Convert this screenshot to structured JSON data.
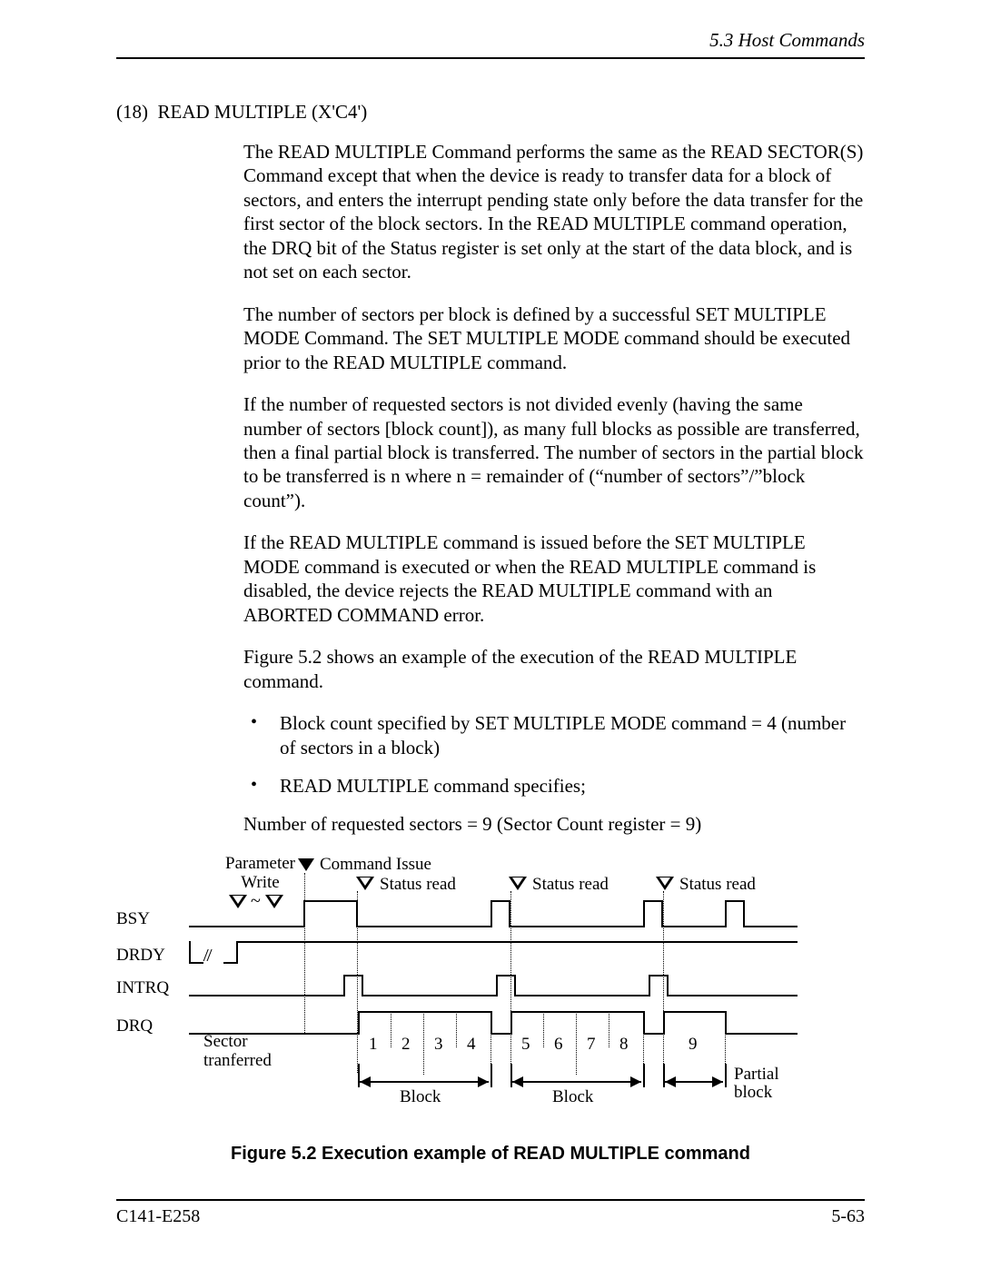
{
  "header": {
    "section": "5.3  Host Commands"
  },
  "title": "(18)  READ MULTIPLE (X'C4')",
  "paragraphs": {
    "p1": "The READ MULTIPLE Command performs the same as the READ SECTOR(S) Command except that when the device is ready to transfer data for a block of sectors, and enters the interrupt pending state only before the data transfer for the first sector of the block sectors.  In the READ MULTIPLE command operation, the DRQ bit of the Status register is set only at the start of the data block, and is not set on each sector.",
    "p2": "The number of sectors per block is defined by a successful SET MULTIPLE MODE Command.  The SET MULTIPLE MODE command should be executed prior to the READ MULTIPLE command.",
    "p3": "If the number of requested sectors is not divided evenly (having the same number of sectors [block count]), as many full blocks as possible are transferred, then a final partial block is transferred. The number of sectors in the partial block to be transferred is n where n = remainder of (“number of sectors”/”block count”).",
    "p4": "If the READ MULTIPLE command is issued before the SET MULTIPLE MODE command is executed or when the READ MULTIPLE command is disabled, the device rejects the READ MULTIPLE command with an ABORTED COMMAND error.",
    "p5": "Figure 5.2 shows an example of the execution of the READ MULTIPLE command.",
    "b1": "Block count specified by SET MULTIPLE MODE command = 4 (number of sectors in a block)",
    "b2": "READ MULTIPLE command specifies;",
    "p6": "Number of requested sectors = 9 (Sector Count register = 9)"
  },
  "figure": {
    "labels": {
      "param_write": "Parameter\nWrite",
      "command_issue": "Command Issue",
      "status_read": "Status read",
      "sector_transferred": "Sector\ntranferred",
      "block": "Block",
      "partial_block": "Partial\nblock"
    },
    "signals": [
      "BSY",
      "DRDY",
      "INTRQ",
      "DRQ"
    ],
    "sectors": [
      "1",
      "2",
      "3",
      "4",
      "5",
      "6",
      "7",
      "8",
      "9"
    ],
    "caption": "Figure 5.2  Execution example of READ MULTIPLE command"
  },
  "footer": {
    "left": "C141-E258",
    "right": "5-63"
  },
  "chart_data": {
    "type": "timing-diagram",
    "description": "READ MULTIPLE command execution: BSY, DRDY, INTRQ, DRQ signal timing across 9 sector transfers grouped into two full blocks of 4 and one partial block of 1.",
    "block_count": 4,
    "requested_sectors": 9,
    "groups": [
      {
        "label": "Block",
        "sectors": [
          1,
          2,
          3,
          4
        ]
      },
      {
        "label": "Block",
        "sectors": [
          5,
          6,
          7,
          8
        ]
      },
      {
        "label": "Partial block",
        "sectors": [
          9
        ]
      }
    ],
    "events": [
      "Parameter Write",
      "Command Issue",
      "Status read (after block 1)",
      "Status read (after block 2)",
      "Status read (after partial block)"
    ],
    "signals": {
      "BSY": "low → high after command issue → low during each block transfer window → high between blocks",
      "DRDY": "rises once near start and stays high",
      "INTRQ": "short high pulse at the start of each block (3 pulses)",
      "DRQ": "high during each block's sector-transfer span, low between blocks"
    }
  }
}
